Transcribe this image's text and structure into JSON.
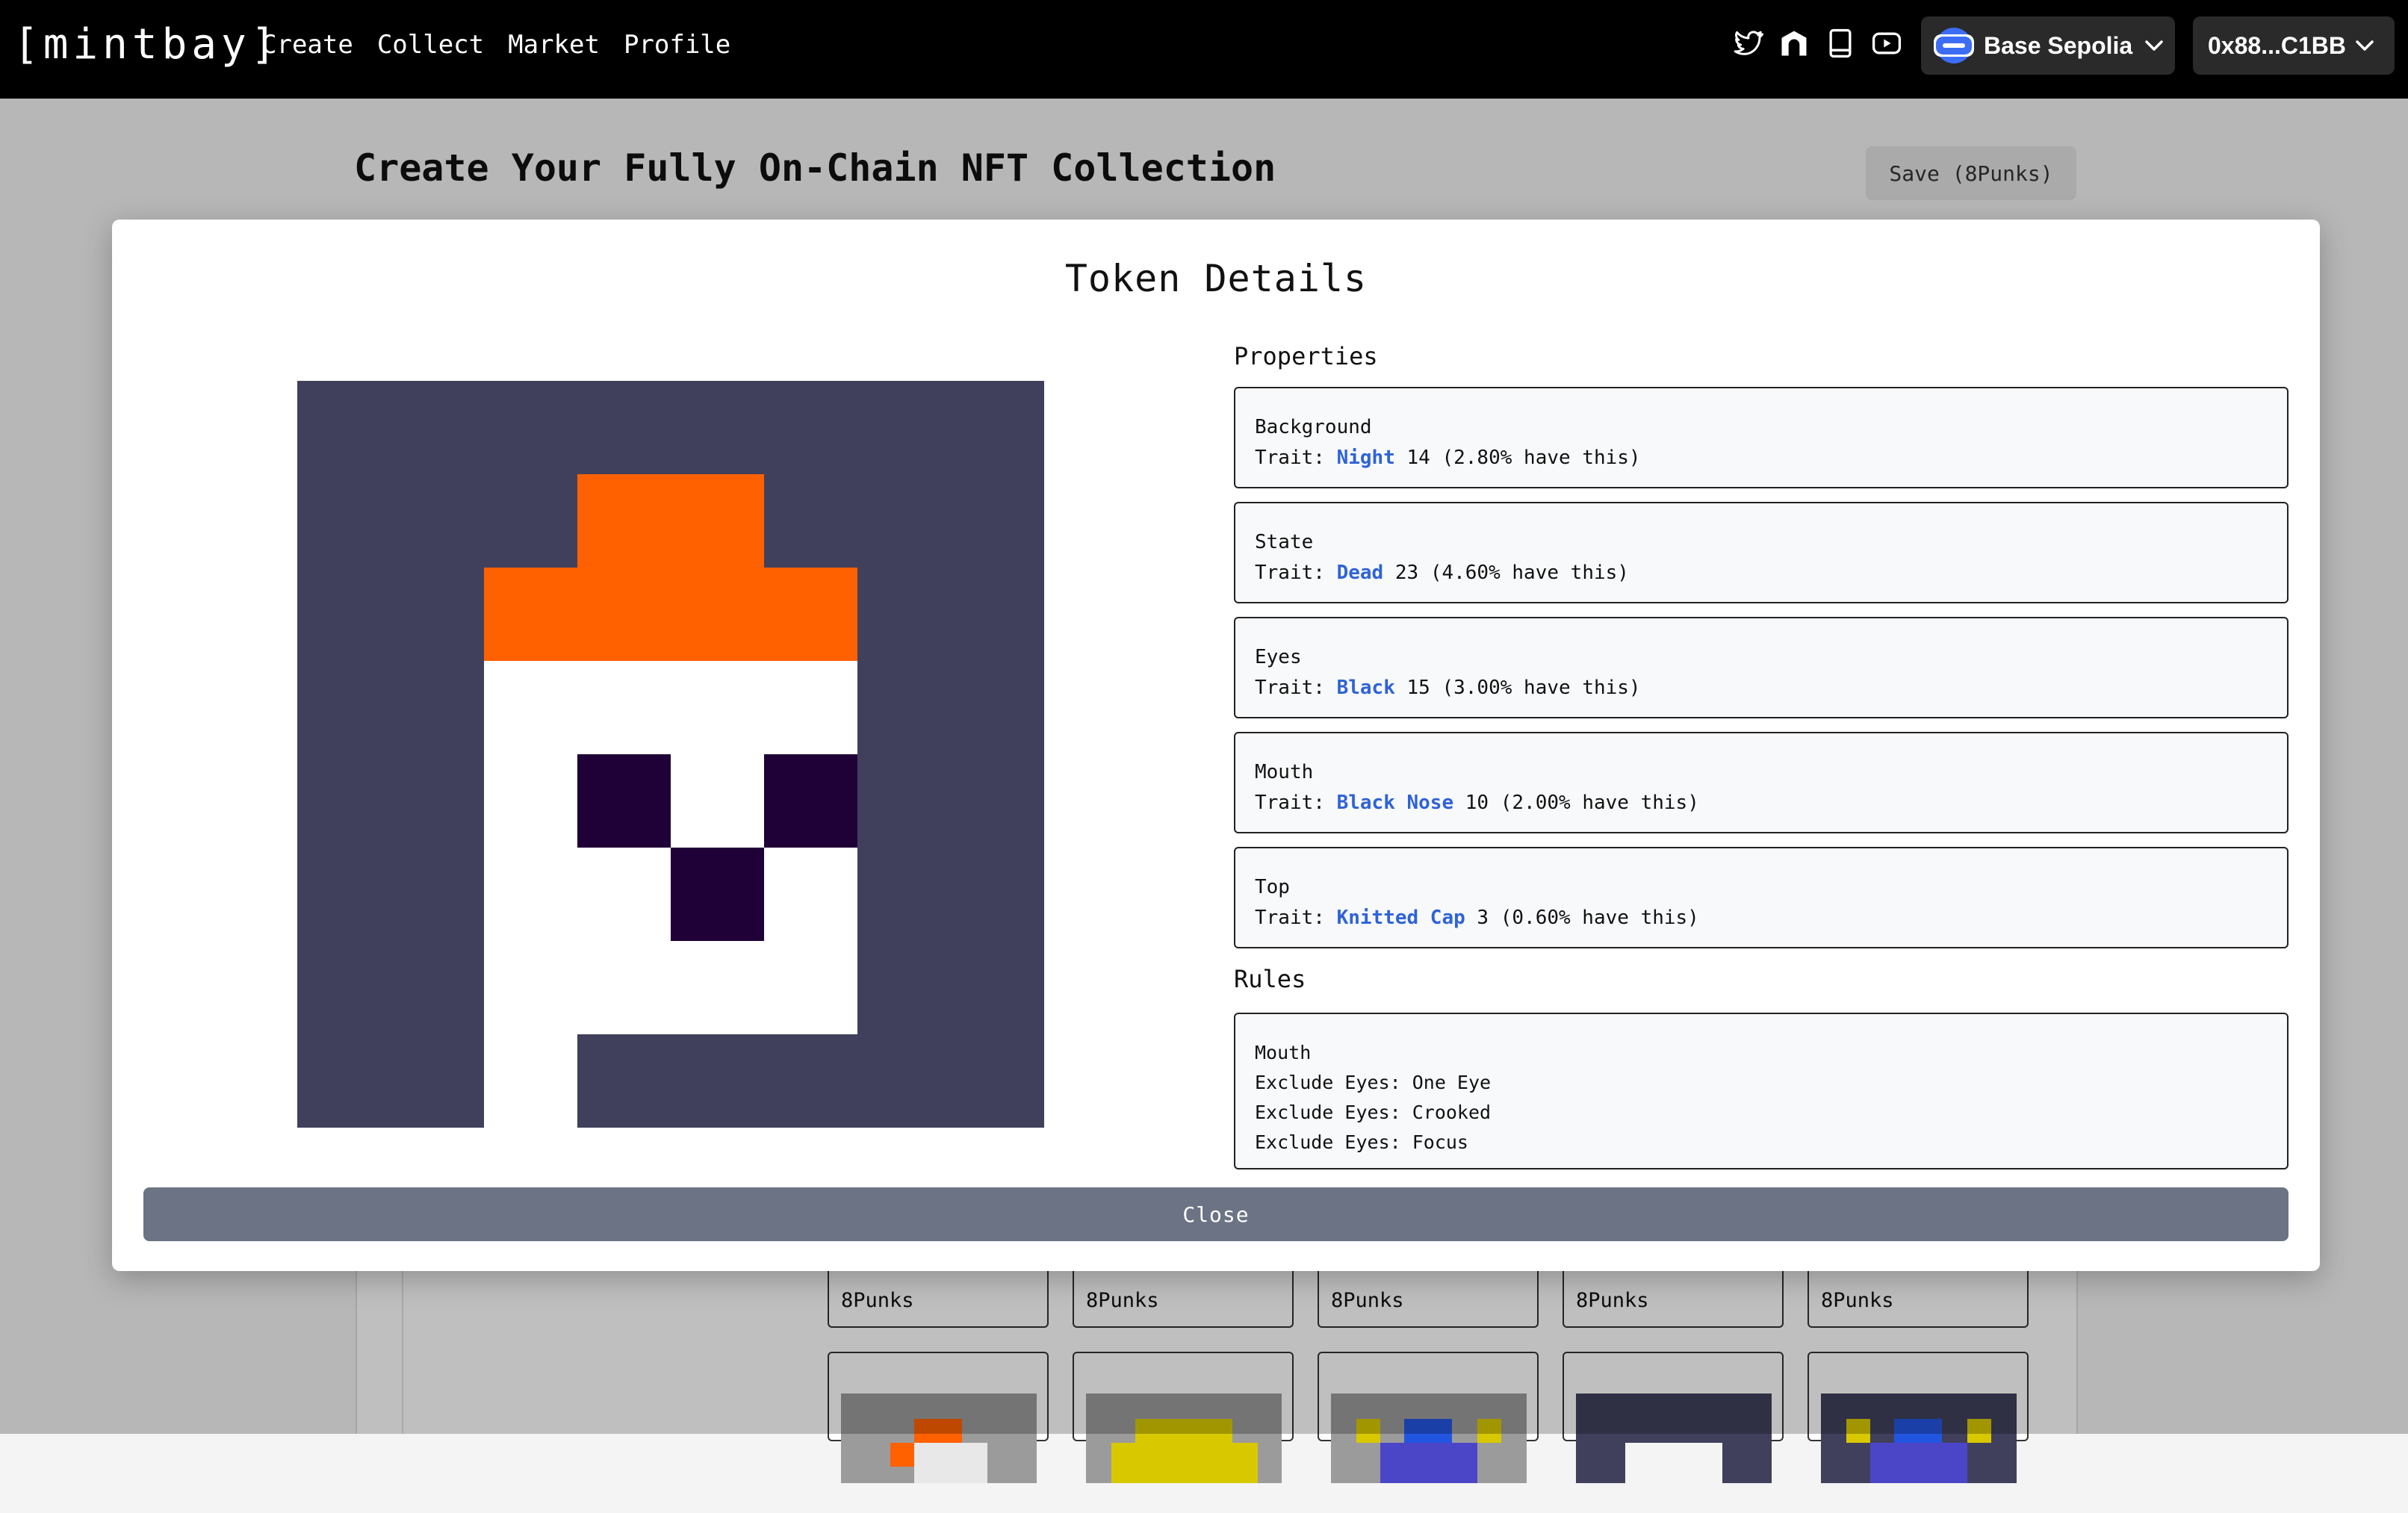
{
  "brand": "[mintbay]",
  "nav": [
    "Create",
    "Collect",
    "Market",
    "Profile"
  ],
  "social_icons": [
    "twitter-icon",
    "gateway-icon",
    "book-icon",
    "youtube-icon"
  ],
  "network": {
    "label": "Base Sepolia",
    "icon": "base-network-icon"
  },
  "wallet": {
    "label": "0x88...C1BB"
  },
  "page": {
    "title": "Create Your Fully On-Chain NFT Collection",
    "save_label": "Save (8Punks)"
  },
  "cards": [
    {
      "label": "8Punks"
    },
    {
      "label": "8Punks"
    },
    {
      "label": "8Punks"
    },
    {
      "label": "8Punks"
    },
    {
      "label": "8Punks"
    }
  ],
  "modal": {
    "title": "Token Details",
    "properties_heading": "Properties",
    "trait_prefix": "Trait:",
    "properties": [
      {
        "name": "Background",
        "value": "Night",
        "detail": "14 (2.80% have this)"
      },
      {
        "name": "State",
        "value": "Dead",
        "detail": "23 (4.60% have this)"
      },
      {
        "name": "Eyes",
        "value": "Black",
        "detail": "15 (3.00% have this)"
      },
      {
        "name": "Mouth",
        "value": "Black Nose",
        "detail": "10 (2.00% have this)"
      },
      {
        "name": "Top",
        "value": "Knitted Cap",
        "detail": "3 (0.60% have this)"
      }
    ],
    "rules_heading": "Rules",
    "rules": {
      "name": "Mouth",
      "items": [
        "Exclude Eyes: One Eye",
        "Exclude Eyes: Crooked",
        "Exclude Eyes: Focus"
      ]
    },
    "close_label": "Close"
  },
  "colors": {
    "night": "#40405c",
    "cap": "#ff6100",
    "skin": "#ffffff",
    "feature": "#1f0037",
    "trait_value": "#2f63d6",
    "close_button": "#6b7384"
  },
  "pixel_grid": [
    "NNNNNNNN",
    "NNNCCNNN",
    "NNCCCCNN",
    "NNWWWWNN",
    "NNWFWFNN",
    "NNWWFWNN",
    "NNWWWWNN",
    "NNWNNNNN"
  ]
}
